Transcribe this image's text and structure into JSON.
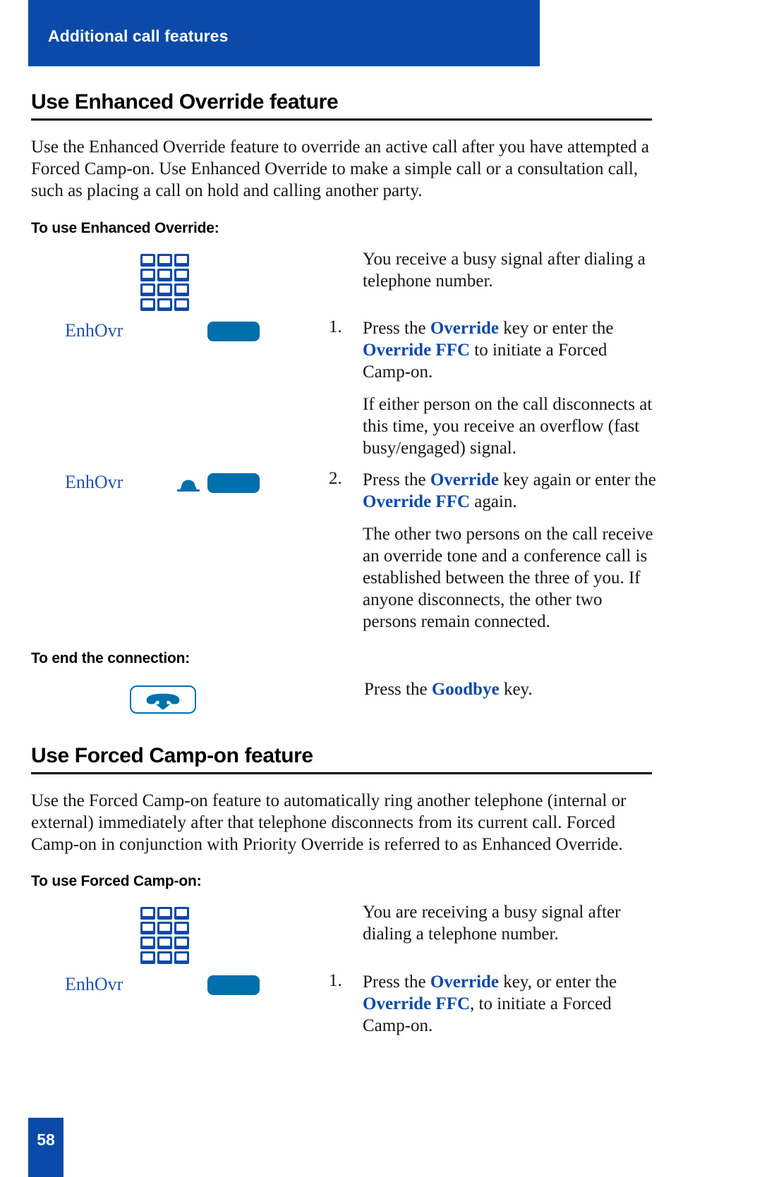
{
  "header": {
    "running_title": "Additional call features"
  },
  "colors": {
    "brand_blue": "#0B4AA8",
    "key_blue": "#0070AD",
    "link_blue": "#2051B5"
  },
  "sections": [
    {
      "title": "Use Enhanced Override feature",
      "intro": "Use the Enhanced Override feature to override an active call after you have attempted a Forced Camp-on. Use Enhanced Override to make a simple call or a consultation call, such as placing a call on hold and calling another party.",
      "subhead": "To use Enhanced Override:",
      "keypad_note": "You receive a busy signal after dialing a telephone number.",
      "step1_number": "1.",
      "step1_key_label": "EnhOvr",
      "step1_text_a": "Press the ",
      "step1_text_b": "Override",
      "step1_text_c": " key or enter the ",
      "step1_text_d": "Override FFC",
      "step1_text_e": " to initiate a Forced Camp-on.",
      "step1_note": "If either person on the call disconnects at this time, you receive an overflow (fast busy/engaged) signal.",
      "step2_number": "2.",
      "step2_key_label": "EnhOvr",
      "step2_text_a": "Press the ",
      "step2_text_b": "Override",
      "step2_text_c": " key again or enter the ",
      "step2_text_d": "Override FFC",
      "step2_text_e": " again.",
      "step2_note": "The other two persons on the call receive an override tone and a conference call is established between the three of you. If anyone disconnects, the other two persons remain connected.",
      "end_subhead": "To end the connection:",
      "end_text_a": "Press the ",
      "end_text_b": "Goodbye",
      "end_text_c": " key."
    },
    {
      "title": "Use Forced Camp-on feature",
      "intro": "Use the Forced Camp-on feature to automatically ring another telephone (internal or external) immediately after that telephone disconnects from its current call. Forced Camp-on in conjunction with Priority Override is referred to as Enhanced Override.",
      "subhead": "To use Forced Camp-on:",
      "keypad_note": "You are receiving a busy signal after dialing a telephone number.",
      "step1_number": "1.",
      "step1_key_label": "EnhOvr",
      "step1_text_a": "Press the ",
      "step1_text_b": "Override",
      "step1_text_c": " key, or enter the ",
      "step1_text_d": "Override FFC",
      "step1_text_e": ", to initiate a Forced Camp-on."
    }
  ],
  "footer": {
    "page_number": "58"
  },
  "icons": {
    "keypad": "keypad-icon",
    "softkey": "soft-key-icon",
    "handset_up": "handset-off-hook-icon",
    "goodbye": "goodbye-handset-down-icon"
  }
}
